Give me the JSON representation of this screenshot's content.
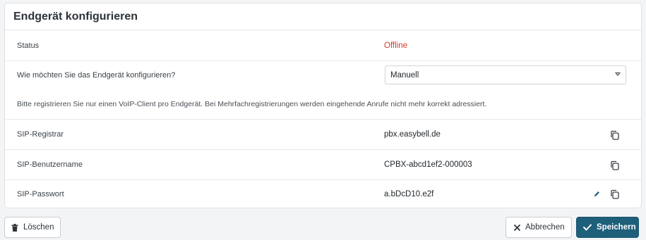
{
  "card": {
    "title": "Endgerät konfigurieren"
  },
  "status": {
    "label": "Status",
    "value": "Offline",
    "value_color": "#d9392b"
  },
  "config": {
    "label": "Wie möchten Sie das Endgerät konfigurieren?",
    "selected": "Manuell",
    "hint": "Bitte registrieren Sie nur einen VoIP-Client pro Endgerät. Bei Mehrfachregistrierungen werden eingehende Anrufe nicht mehr korrekt adressiert."
  },
  "sip": {
    "registrar_label": "SIP-Registrar",
    "registrar_value": "pbx.easybell.de",
    "username_label": "SIP-Benutzername",
    "username_value": "CPBX-abcd1ef2-000003",
    "password_label": "SIP-Passwort",
    "password_value": "a.bDcD10.e2f"
  },
  "icons": {
    "copy": "copy-icon",
    "edit": "pencil-icon",
    "delete": "trash-icon",
    "cancel": "close-icon",
    "save": "check-icon"
  },
  "actions": {
    "delete_label": "Löschen",
    "cancel_label": "Abbrechen",
    "save_label": "Speichern"
  },
  "colors": {
    "primary": "#1e5f7a",
    "offline": "#d9392b"
  }
}
